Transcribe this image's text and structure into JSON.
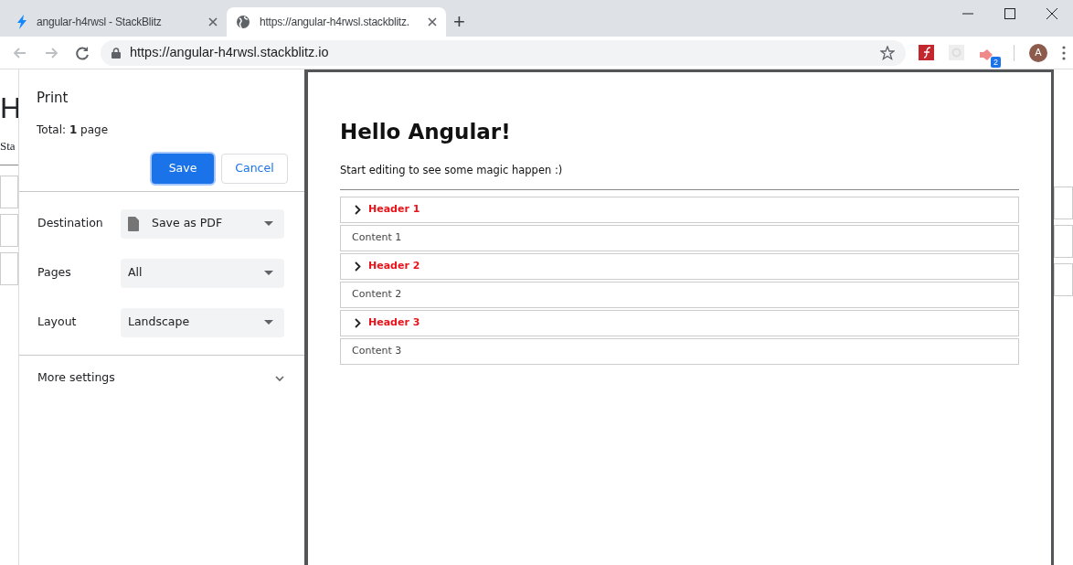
{
  "browser": {
    "tabs": [
      {
        "title": "angular-h4rwsl - StackBlitz",
        "selected": false
      },
      {
        "title": "https://angular-h4rwsl.stackblitz.",
        "selected": true
      }
    ],
    "new_tab": "+",
    "address": "https://angular-h4rwsl.stackblitz.io",
    "extension_badge": "2",
    "avatar": "A"
  },
  "background_page": {
    "heading": "H",
    "subtitle": "Sta"
  },
  "print_dialog": {
    "title": "Print",
    "total": "Total: **1** page",
    "buttons": [
      {
        "label": "Save",
        "kind": "primary"
      },
      {
        "label": "Cancel",
        "kind": "secondary"
      }
    ],
    "settings": [
      {
        "label": "Destination",
        "value": "Save as PDF",
        "kind": "destination"
      },
      {
        "label": "Pages",
        "value": "All",
        "kind": "plain"
      },
      {
        "label": "Layout",
        "value": "Landscape",
        "kind": "plain"
      }
    ],
    "more_settings": "More settings"
  },
  "preview": {
    "heading": "Hello Angular!",
    "text": "Start editing to see some magic happen :)",
    "items": [
      {
        "kind": "header",
        "label": "Header 1"
      },
      {
        "kind": "content",
        "label": "Content 1"
      },
      {
        "kind": "header",
        "label": "Header 2"
      },
      {
        "kind": "content",
        "label": "Content 2"
      },
      {
        "kind": "header",
        "label": "Header 3"
      },
      {
        "kind": "content",
        "label": "Content 3"
      }
    ]
  }
}
